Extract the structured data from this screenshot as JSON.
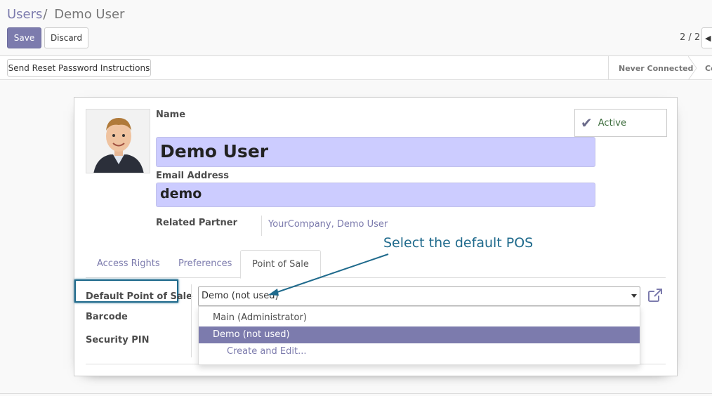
{
  "breadcrumb": {
    "parent": "Users",
    "separator": "/",
    "current": "Demo User"
  },
  "toolbar": {
    "save_label": "Save",
    "discard_label": "Discard"
  },
  "pager": {
    "value": "2 / 2"
  },
  "statusbar": {
    "reset_label": "Send Reset Password Instructions",
    "stage_current": "Never Connected",
    "stage_next": "Co"
  },
  "form": {
    "name_label": "Name",
    "name_value": "Demo User",
    "email_label": "Email Address",
    "email_value": "demo",
    "partner_label": "Related Partner",
    "partner_value": "YourCompany, Demo User",
    "active_label": "Active"
  },
  "tabs": [
    {
      "label": "Access Rights"
    },
    {
      "label": "Preferences"
    },
    {
      "label": "Point of Sale"
    }
  ],
  "pos_tab": {
    "default_pos_label": "Default Point of Sale",
    "default_pos_value": "Demo (not used)",
    "barcode_label": "Barcode",
    "pin_label": "Security PIN",
    "options": [
      {
        "label": "Main (Administrator)"
      },
      {
        "label": "Demo (not used)"
      },
      {
        "label": "Create and Edit..."
      }
    ]
  },
  "annotation": {
    "text": "Select the default POS"
  },
  "colors": {
    "accent": "#7c7bad",
    "field_bg": "#ccccff",
    "callout": "#1f6a8c"
  }
}
